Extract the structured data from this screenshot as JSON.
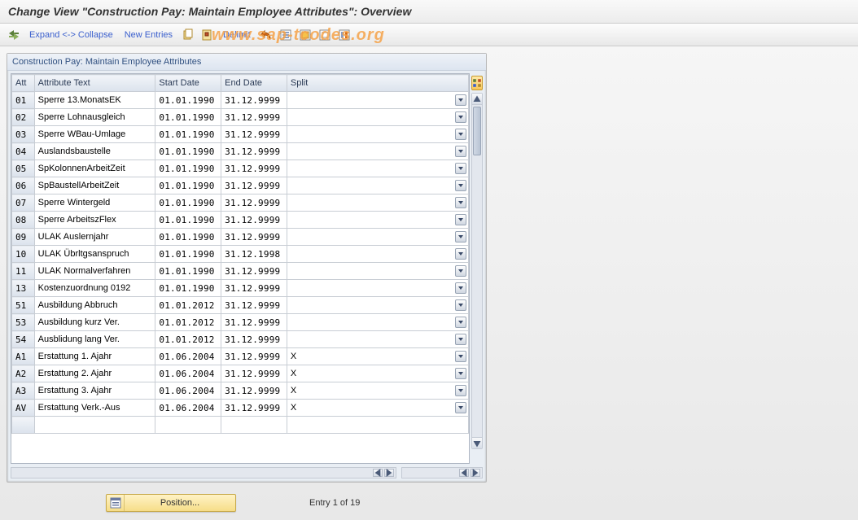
{
  "title": "Change View \"Construction Pay: Maintain Employee Attributes\": Overview",
  "toolbar": {
    "expand_collapse": "Expand <-> Collapse",
    "new_entries": "New Entries",
    "delimit": "Delimit"
  },
  "watermark": "www.sap-tcodes.org",
  "frame": {
    "title": "Construction Pay: Maintain Employee Attributes"
  },
  "columns": {
    "att": "Att",
    "attribute_text": "Attribute Text",
    "start_date": "Start Date",
    "end_date": "End Date",
    "split": "Split"
  },
  "rows": [
    {
      "att": "01",
      "text": "Sperre 13.MonatsEK",
      "start": "01.01.1990",
      "end": "31.12.9999",
      "split": ""
    },
    {
      "att": "02",
      "text": "Sperre Lohnausgleich",
      "start": "01.01.1990",
      "end": "31.12.9999",
      "split": ""
    },
    {
      "att": "03",
      "text": "Sperre WBau-Umlage",
      "start": "01.01.1990",
      "end": "31.12.9999",
      "split": ""
    },
    {
      "att": "04",
      "text": "Auslandsbaustelle",
      "start": "01.01.1990",
      "end": "31.12.9999",
      "split": ""
    },
    {
      "att": "05",
      "text": "SpKolonnenArbeitZeit",
      "start": "01.01.1990",
      "end": "31.12.9999",
      "split": ""
    },
    {
      "att": "06",
      "text": "SpBaustellArbeitZeit",
      "start": "01.01.1990",
      "end": "31.12.9999",
      "split": ""
    },
    {
      "att": "07",
      "text": "Sperre Wintergeld",
      "start": "01.01.1990",
      "end": "31.12.9999",
      "split": ""
    },
    {
      "att": "08",
      "text": "Sperre ArbeitszFlex",
      "start": "01.01.1990",
      "end": "31.12.9999",
      "split": ""
    },
    {
      "att": "09",
      "text": "ULAK Auslernjahr",
      "start": "01.01.1990",
      "end": "31.12.9999",
      "split": ""
    },
    {
      "att": "10",
      "text": "ULAK Übrltgsanspruch",
      "start": "01.01.1990",
      "end": "31.12.1998",
      "split": ""
    },
    {
      "att": "11",
      "text": "ULAK Normalverfahren",
      "start": "01.01.1990",
      "end": "31.12.9999",
      "split": ""
    },
    {
      "att": "13",
      "text": "Kostenzuordnung 0192",
      "start": "01.01.1990",
      "end": "31.12.9999",
      "split": ""
    },
    {
      "att": "51",
      "text": "Ausbildung Abbruch",
      "start": "01.01.2012",
      "end": "31.12.9999",
      "split": ""
    },
    {
      "att": "53",
      "text": "Ausbildung kurz Ver.",
      "start": "01.01.2012",
      "end": "31.12.9999",
      "split": ""
    },
    {
      "att": "54",
      "text": "Ausblidung lang Ver.",
      "start": "01.01.2012",
      "end": "31.12.9999",
      "split": ""
    },
    {
      "att": "A1",
      "text": "Erstattung  1. Ajahr",
      "start": "01.06.2004",
      "end": "31.12.9999",
      "split": "X"
    },
    {
      "att": "A2",
      "text": "Erstattung 2. Ajahr",
      "start": "01.06.2004",
      "end": "31.12.9999",
      "split": "X"
    },
    {
      "att": "A3",
      "text": "Erstattung 3. Ajahr",
      "start": "01.06.2004",
      "end": "31.12.9999",
      "split": "X"
    },
    {
      "att": "AV",
      "text": "Erstattung Verk.-Aus",
      "start": "01.06.2004",
      "end": "31.12.9999",
      "split": "X"
    }
  ],
  "footer": {
    "position_btn": "Position...",
    "entry_text": "Entry 1 of 19"
  }
}
